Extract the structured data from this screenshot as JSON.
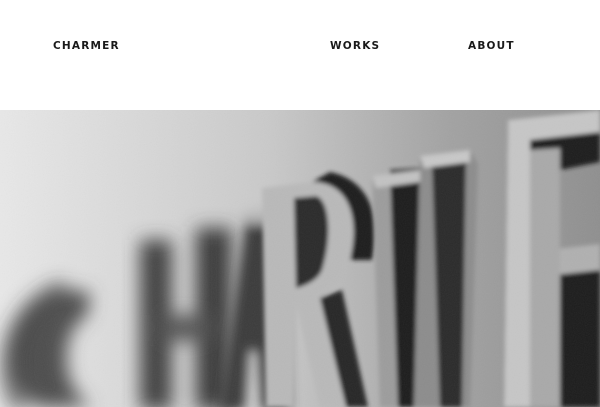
{
  "header": {
    "brand": "CHARMER",
    "nav": {
      "works": "WORKS",
      "about": "ABOUT"
    }
  },
  "hero": {
    "image_name": "photo of dimensional metal letters spelling CHARMER",
    "style": "grayscale"
  },
  "colors": {
    "background": "#ffffff",
    "text": "#1a1a1a"
  }
}
